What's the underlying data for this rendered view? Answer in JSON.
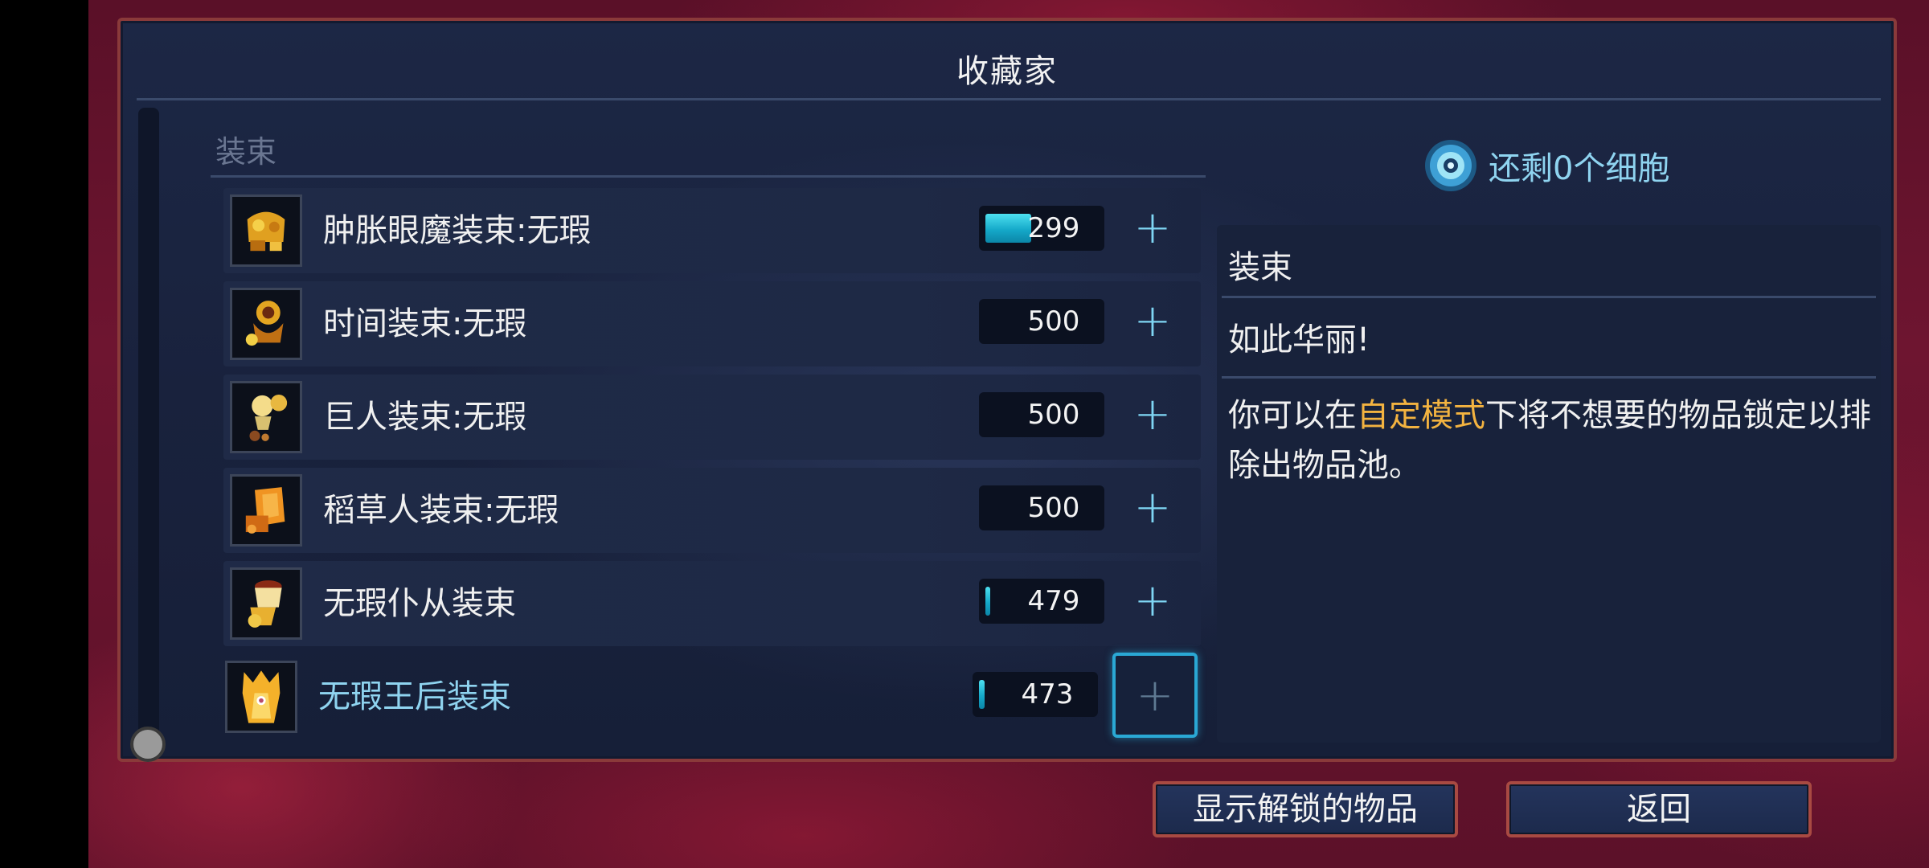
{
  "window": {
    "title": "收藏家"
  },
  "section": {
    "label": "装束"
  },
  "items": [
    {
      "name": "肿胀眼魔装束:无瑕",
      "cost": "299",
      "progress": 0.41,
      "icon": "outfit-icon"
    },
    {
      "name": "时间装束:无瑕",
      "cost": "500",
      "progress": 0,
      "icon": "outfit-icon"
    },
    {
      "name": "巨人装束:无瑕",
      "cost": "500",
      "progress": 0,
      "icon": "outfit-icon"
    },
    {
      "name": "稻草人装束:无瑕",
      "cost": "500",
      "progress": 0,
      "icon": "outfit-icon"
    },
    {
      "name": "无瑕仆从装束",
      "cost": "479",
      "progress": 0.04,
      "icon": "outfit-icon"
    },
    {
      "name": "无瑕王后装束",
      "cost": "473",
      "progress": 0.05,
      "icon": "outfit-icon",
      "selected": true
    }
  ],
  "plus_label": "+",
  "cells": {
    "text": "还剩0个细胞",
    "icon": "cell-icon"
  },
  "description": {
    "heading": "装束",
    "quote": "如此华丽!",
    "body_before": "你可以在",
    "body_highlight": "自定模式",
    "body_after": "下将不想要的物品锁定以排除出物品池。"
  },
  "buttons": {
    "show_unlocked": "显示解锁的物品",
    "back": "返回"
  },
  "colors": {
    "accent": "#8fd4f0",
    "highlight": "#f3b340",
    "border": "#8a3a3a"
  }
}
